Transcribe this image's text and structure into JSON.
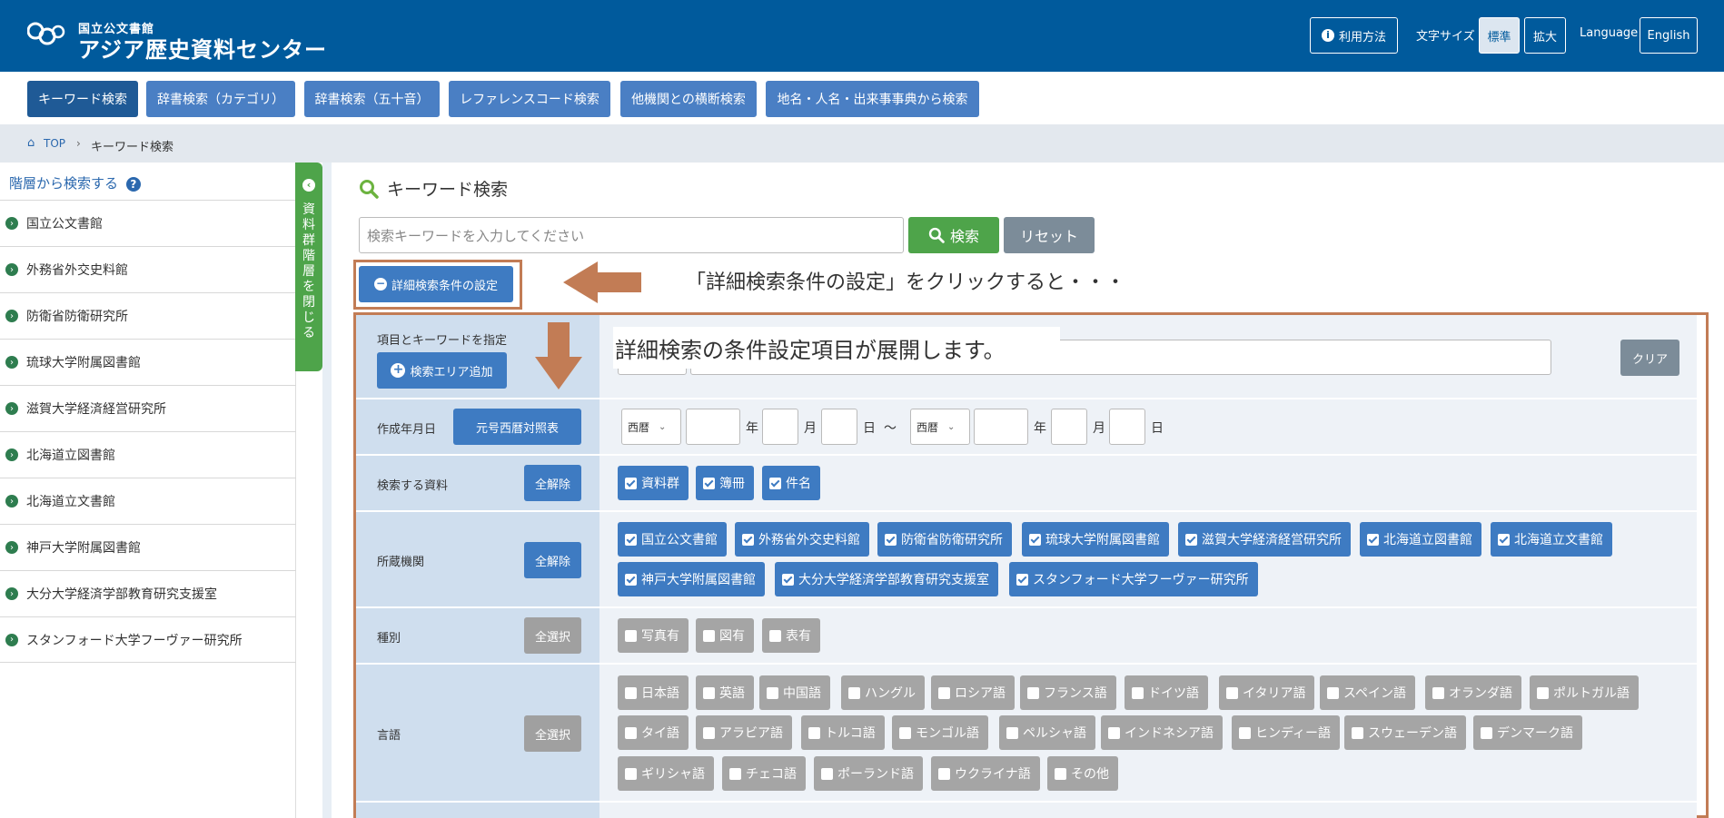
{
  "header": {
    "logo_sub": "国立公文書館",
    "logo_main": "アジア歴史資料センター",
    "usage_label": "利用方法",
    "font_size_label": "文字サイズ",
    "font_standard": "標準",
    "font_large": "拡大",
    "language_label": "Language",
    "language_value": "English"
  },
  "nav": {
    "tabs": [
      {
        "label": "キーワード検索"
      },
      {
        "label": "辞書検索（カテゴリ）"
      },
      {
        "label": "辞書検索（五十音）"
      },
      {
        "label": "レファレンスコード検索"
      },
      {
        "label": "他機関との横断検索"
      },
      {
        "label": "地名・人名・出来事事典から検索"
      }
    ]
  },
  "breadcrumb": {
    "top": "TOP",
    "current": "キーワード検索"
  },
  "sidebar": {
    "heading": "階層から検索する",
    "items": [
      {
        "label": "国立公文書館"
      },
      {
        "label": "外務省外交史料館"
      },
      {
        "label": "防衛省防衛研究所"
      },
      {
        "label": "琉球大学附属図書館"
      },
      {
        "label": "滋賀大学経済経営研究所"
      },
      {
        "label": "北海道立図書館"
      },
      {
        "label": "北海道立文書館"
      },
      {
        "label": "神戸大学附属図書館"
      },
      {
        "label": "大分大学経済学部教育研究支援室"
      },
      {
        "label": "スタンフォード大学フーヴァー研究所"
      }
    ],
    "collapse_tab": "資料群階層を閉じる"
  },
  "main": {
    "title": "キーワード検索",
    "search_placeholder": "検索キーワードを入力してください",
    "search_button": "検索",
    "reset_button": "リセット",
    "detail_button": "詳細検索条件の設定",
    "annotation_1": "「詳細検索条件の設定」をクリックすると・・・",
    "annotation_2": "詳細検索の条件設定項目が展開します。"
  },
  "form": {
    "keyword_row": {
      "label": "項目とキーワードを指定",
      "add_button": "検索エリア追加",
      "clear_button": "クリア"
    },
    "date_row": {
      "label": "作成年月日",
      "table_button": "元号西暦対照表",
      "era_from": "西暦",
      "era_to": "西暦",
      "year": "年",
      "month": "月",
      "day": "日",
      "tilde": "～"
    },
    "material_row": {
      "label": "検索する資料",
      "button": "全解除",
      "options": [
        "資料群",
        "簿冊",
        "件名"
      ]
    },
    "holder_row": {
      "label": "所蔵機関",
      "button": "全解除",
      "options": [
        "国立公文書館",
        "外務省外交史料館",
        "防衛省防衛研究所",
        "琉球大学附属図書館",
        "滋賀大学経済経営研究所",
        "北海道立図書館",
        "北海道立文書館",
        "神戸大学附属図書館",
        "大分大学経済学部教育研究支援室",
        "スタンフォード大学フーヴァー研究所"
      ]
    },
    "type_row": {
      "label": "種別",
      "button": "全選択",
      "options": [
        "写真有",
        "図有",
        "表有"
      ]
    },
    "language_row": {
      "label": "言語",
      "button": "全選択",
      "options": [
        "日本語",
        "英語",
        "中国語",
        "ハングル",
        "ロシア語",
        "フランス語",
        "ドイツ語",
        "イタリア語",
        "スペイン語",
        "オランダ語",
        "ポルトガル語",
        "タイ語",
        "アラビア語",
        "トルコ語",
        "モンゴル語",
        "ペルシャ語",
        "インドネシア語",
        "ヒンディー語",
        "スウェーデン語",
        "デンマーク語",
        "ギリシャ語",
        "チェコ語",
        "ポーランド語",
        "ウクライナ語",
        "その他"
      ]
    }
  },
  "colors": {
    "header": "#005a9c",
    "tab": "#4a7fc4",
    "tab_active": "#1f5a96",
    "green": "#4ea44a",
    "annotation": "#c27c55"
  }
}
